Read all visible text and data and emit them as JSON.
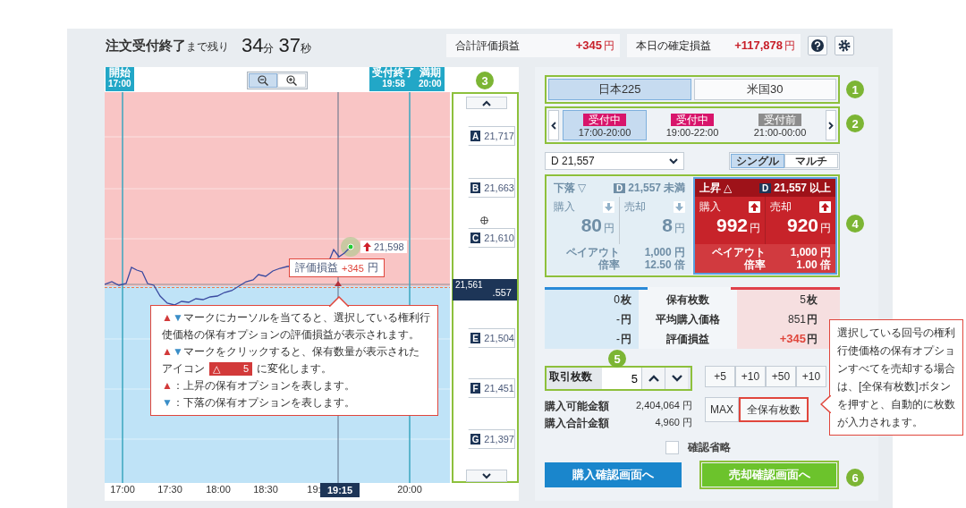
{
  "header": {
    "title": "注文受付終了",
    "title_suffix": "まで残り",
    "minutes": "34",
    "minutes_unit": "分",
    "seconds": "37",
    "seconds_unit": "秒",
    "summaries": [
      {
        "label": "合計評価損益",
        "value": "+345",
        "unit": "円"
      },
      {
        "label": "本日の確定損益",
        "value": "+117,878",
        "unit": "円"
      }
    ]
  },
  "chart": {
    "markers": [
      {
        "label": "開始",
        "time": "17:00"
      },
      {
        "label": "受付終了",
        "time": "19:58"
      },
      {
        "label": "満期",
        "time": "20:00"
      }
    ],
    "zoom_buttons": [
      {
        "kind": "zoom-out",
        "selected": true
      },
      {
        "kind": "zoom-in",
        "selected": false
      }
    ],
    "x_labels": [
      "17:00",
      "17:30",
      "18:00",
      "18:30",
      "19:",
      "20:00"
    ],
    "cursor_time": "19:15",
    "last_price": "21,598",
    "pnl_tag": {
      "label": "評価損益",
      "value": "+345",
      "unit": "円"
    },
    "strike_ladder": [
      {
        "kind": "strike",
        "letter": "A",
        "price": "21,717"
      },
      {
        "kind": "strike",
        "letter": "B",
        "price": "21,663"
      },
      {
        "kind": "strike",
        "letter": "C",
        "price": "21,610"
      },
      {
        "kind": "current",
        "current_price": "21,561",
        "price": ".557"
      },
      {
        "kind": "strike",
        "letter": "E",
        "price": "21,504"
      },
      {
        "kind": "strike",
        "letter": "F",
        "price": "21,451"
      },
      {
        "kind": "strike",
        "letter": "G",
        "price": "21,397"
      }
    ]
  },
  "chart_callout": {
    "paragraphs": [
      [
        {
          "kind": "up",
          "text": "▲"
        },
        {
          "kind": "down",
          "text": "▼"
        },
        {
          "kind": "text",
          "text": "マークにカーソルを当てると、選択している権利行使価格の保有オプションの評価損益が表示されます。"
        }
      ],
      [
        {
          "kind": "up",
          "text": "▲"
        },
        {
          "kind": "down",
          "text": "▼"
        },
        {
          "kind": "text",
          "text": "マークをクリックすると、保有数量が表示された"
        }
      ],
      [
        {
          "kind": "text",
          "text": "アイコン"
        },
        {
          "kind": "badge",
          "symbol": "△",
          "count": "5"
        },
        {
          "kind": "text",
          "text": "に変化します。"
        }
      ],
      [
        {
          "kind": "up",
          "text": "▲"
        },
        {
          "kind": "text",
          "text": "：上昇の保有オプションを表します。"
        }
      ],
      [
        {
          "kind": "down",
          "text": "▼"
        },
        {
          "kind": "text",
          "text": "：下落の保有オプションを表します。"
        }
      ]
    ]
  },
  "markets": [
    {
      "label": "日本225",
      "selected": true
    },
    {
      "label": "米国30",
      "selected": false
    }
  ],
  "sessions": [
    {
      "status": "受付中",
      "color": "#d8156b",
      "time": "17:00-20:00",
      "selected": true
    },
    {
      "status": "受付中",
      "color": "#d8156b",
      "time": "19:00-22:00",
      "selected": false
    },
    {
      "status": "受付前",
      "color": "#8d8d8d",
      "time": "21:00-00:00",
      "selected": false
    }
  ],
  "strike_select": {
    "value": "D 21,557"
  },
  "modes": [
    {
      "label": "シングル",
      "selected": true
    },
    {
      "label": "マルチ",
      "selected": false
    }
  ],
  "options": [
    {
      "kind": "down",
      "title": "下落",
      "symbol": "▽",
      "letter": "D",
      "strike": "21,557",
      "strike_suffix": "未満",
      "selected": false,
      "buy_label": "購入",
      "buy_price": "80",
      "buy_unit": "円",
      "sell_label": "売却",
      "sell_price": "8",
      "sell_unit": "円",
      "payout_label": "ペイアウト",
      "payout": "1,000",
      "payout_unit": "円",
      "ratio_label": "倍率",
      "ratio": "12.50",
      "ratio_unit": "倍"
    },
    {
      "kind": "up",
      "title": "上昇",
      "symbol": "△",
      "letter": "D",
      "strike": "21,557",
      "strike_suffix": "以上",
      "selected": true,
      "buy_label": "購入",
      "buy_price": "992",
      "buy_unit": "円",
      "sell_label": "売却",
      "sell_price": "920",
      "sell_unit": "円",
      "payout_label": "ペイアウト",
      "payout": "1,000",
      "payout_unit": "円",
      "ratio_label": "倍率",
      "ratio": "1.00",
      "ratio_unit": "倍"
    }
  ],
  "holdings": [
    {
      "kind": "count",
      "label": "保有枚数",
      "down": "0",
      "down_unit": "枚",
      "up": "5",
      "up_unit": "枚"
    },
    {
      "kind": "price",
      "label": "平均購入価格",
      "down": "-",
      "down_unit": "円",
      "up": "851",
      "up_unit": "円"
    },
    {
      "kind": "pnl",
      "label": "評価損益",
      "down": "-",
      "down_unit": "円",
      "up": "+345",
      "up_unit": "円"
    }
  ],
  "order": {
    "quantity_label": "取引枚数",
    "quantity": "5",
    "increments": [
      "+5",
      "+10",
      "+50",
      "+10"
    ],
    "max": "MAX",
    "all_holdings": "全保有枚数",
    "available_label": "購入可能金額",
    "available": "2,404,064",
    "available_unit": "円",
    "total_label": "購入合計金額",
    "total": "4,960",
    "total_unit": "円",
    "skip_confirm": {
      "label": "確認省略",
      "checked": false
    },
    "buy_button": "購入確認画面へ",
    "sell_button": "売却確認画面へ"
  },
  "side_callout": {
    "text": "選択している回号の権利行使価格の保有オプションすべてを売却する場合は、[全保有枚数]ボタンを押すと、自動的に枚数が入力されます。"
  },
  "annotations": [
    "1",
    "2",
    "3",
    "4",
    "5",
    "6"
  ]
}
